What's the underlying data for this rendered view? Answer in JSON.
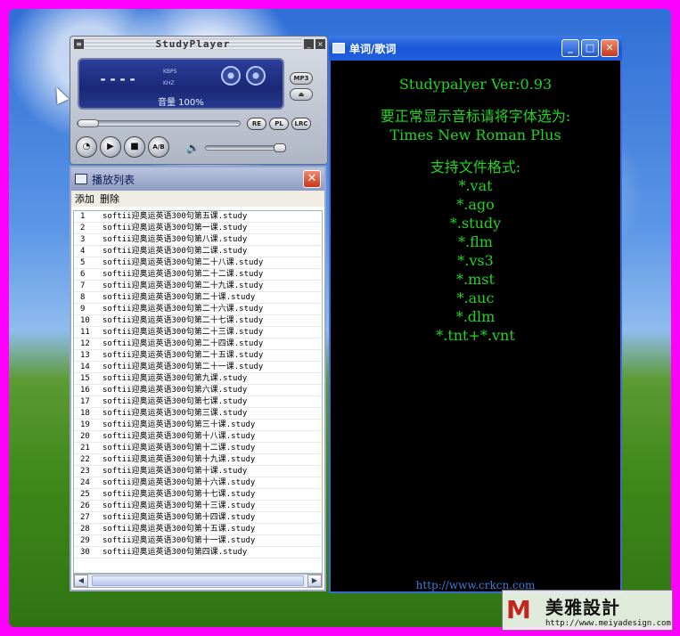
{
  "player": {
    "title": "StudyPlayer",
    "time": "----",
    "kbps_label": "KBPS",
    "khz_label": "KHZ",
    "volume_label": "音量 100%",
    "side_buttons": [
      "MP3",
      "⏏"
    ],
    "small_buttons": [
      "RE",
      "PL",
      "LRC"
    ],
    "ab_label": "A/B"
  },
  "playlist": {
    "title": "播放列表",
    "menu": [
      "添加",
      "删除"
    ],
    "items": [
      {
        "num": "1",
        "name": "softii迎奥运英语300句第五课.study"
      },
      {
        "num": "2",
        "name": "softii迎奥运英语300句第一课.study"
      },
      {
        "num": "3",
        "name": "softii迎奥运英语300句第八课.study"
      },
      {
        "num": "4",
        "name": "softii迎奥运英语300句第二课.study"
      },
      {
        "num": "5",
        "name": "softii迎奥运英语300句第二十八课.study"
      },
      {
        "num": "6",
        "name": "softii迎奥运英语300句第二十二课.study"
      },
      {
        "num": "7",
        "name": "softii迎奥运英语300句第二十九课.study"
      },
      {
        "num": "8",
        "name": "softii迎奥运英语300句第二十课.study"
      },
      {
        "num": "9",
        "name": "softii迎奥运英语300句第二十六课.study"
      },
      {
        "num": "10",
        "name": "softii迎奥运英语300句第二十七课.study"
      },
      {
        "num": "11",
        "name": "softii迎奥运英语300句第二十三课.study"
      },
      {
        "num": "12",
        "name": "softii迎奥运英语300句第二十四课.study"
      },
      {
        "num": "13",
        "name": "softii迎奥运英语300句第二十五课.study"
      },
      {
        "num": "14",
        "name": "softii迎奥运英语300句第二十一课.study"
      },
      {
        "num": "15",
        "name": "softii迎奥运英语300句第九课.study"
      },
      {
        "num": "16",
        "name": "softii迎奥运英语300句第六课.study"
      },
      {
        "num": "17",
        "name": "softii迎奥运英语300句第七课.study"
      },
      {
        "num": "18",
        "name": "softii迎奥运英语300句第三课.study"
      },
      {
        "num": "19",
        "name": "softii迎奥运英语300句第三十课.study"
      },
      {
        "num": "20",
        "name": "softii迎奥运英语300句第十八课.study"
      },
      {
        "num": "21",
        "name": "softii迎奥运英语300句第十二课.study"
      },
      {
        "num": "22",
        "name": "softii迎奥运英语300句第十九课.study"
      },
      {
        "num": "23",
        "name": "softii迎奥运英语300句第十课.study"
      },
      {
        "num": "24",
        "name": "softii迎奥运英语300句第十六课.study"
      },
      {
        "num": "25",
        "name": "softii迎奥运英语300句第十七课.study"
      },
      {
        "num": "26",
        "name": "softii迎奥运英语300句第十三课.study"
      },
      {
        "num": "27",
        "name": "softii迎奥运英语300句第十四课.study"
      },
      {
        "num": "28",
        "name": "softii迎奥运英语300句第十五课.study"
      },
      {
        "num": "29",
        "name": "softii迎奥运英语300句第十一课.study"
      },
      {
        "num": "30",
        "name": "softii迎奥运英语300句第四课.study"
      }
    ]
  },
  "lyrics": {
    "title": "单词/歌词",
    "lines": [
      "Studypalyer Ver:0.93",
      "",
      "要正常显示音标请将字体选为:",
      "Times New Roman Plus",
      "",
      "支持文件格式:",
      "*.vat",
      "*.ago",
      "*.study",
      "*.flm",
      "*.vs3",
      "*.mst",
      "*.auc",
      "*.dlm",
      "*.tnt+*.vnt"
    ],
    "url": "http://www.crkcn.com"
  },
  "watermark": {
    "name": "美雅設計",
    "url": "http://www.meiyadesign.com"
  }
}
